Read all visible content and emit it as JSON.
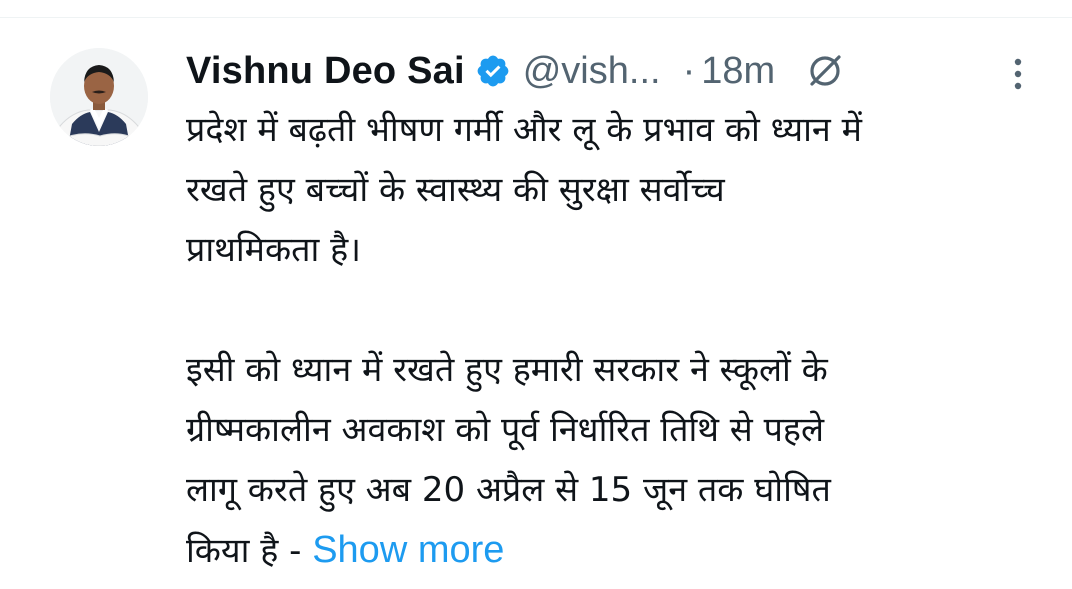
{
  "tweet": {
    "author": {
      "name": "Vishnu Deo Sai",
      "handle": "@vish...",
      "verified": true,
      "avatar_icon": "avatar-photo"
    },
    "separator": "·",
    "time": "18m",
    "header_icons": [
      "verified-badge-icon",
      "grok-icon",
      "more-vertical-icon"
    ],
    "text_lines": [
      "प्रदेश में बढ़ती भीषण गर्मी और लू के प्रभाव को ध्यान में",
      "रखते हुए बच्चों के स्वास्थ्य की सुरक्षा सर्वोच्च",
      "प्राथमिकता है।",
      "",
      "इसी को ध्यान में रखते हुए हमारी सरकार ने स्कूलों के",
      "ग्रीष्मकालीन अवकाश को पूर्व निर्धारित तिथि से पहले",
      "लागू करते हुए अब 20 अप्रैल से 15 जून तक घोषित",
      "किया है -"
    ],
    "show_more": "Show more",
    "colors": {
      "text": "#0f1419",
      "secondary": "#536471",
      "link": "#1d9bf0",
      "verified": "#1d9bf0"
    }
  }
}
